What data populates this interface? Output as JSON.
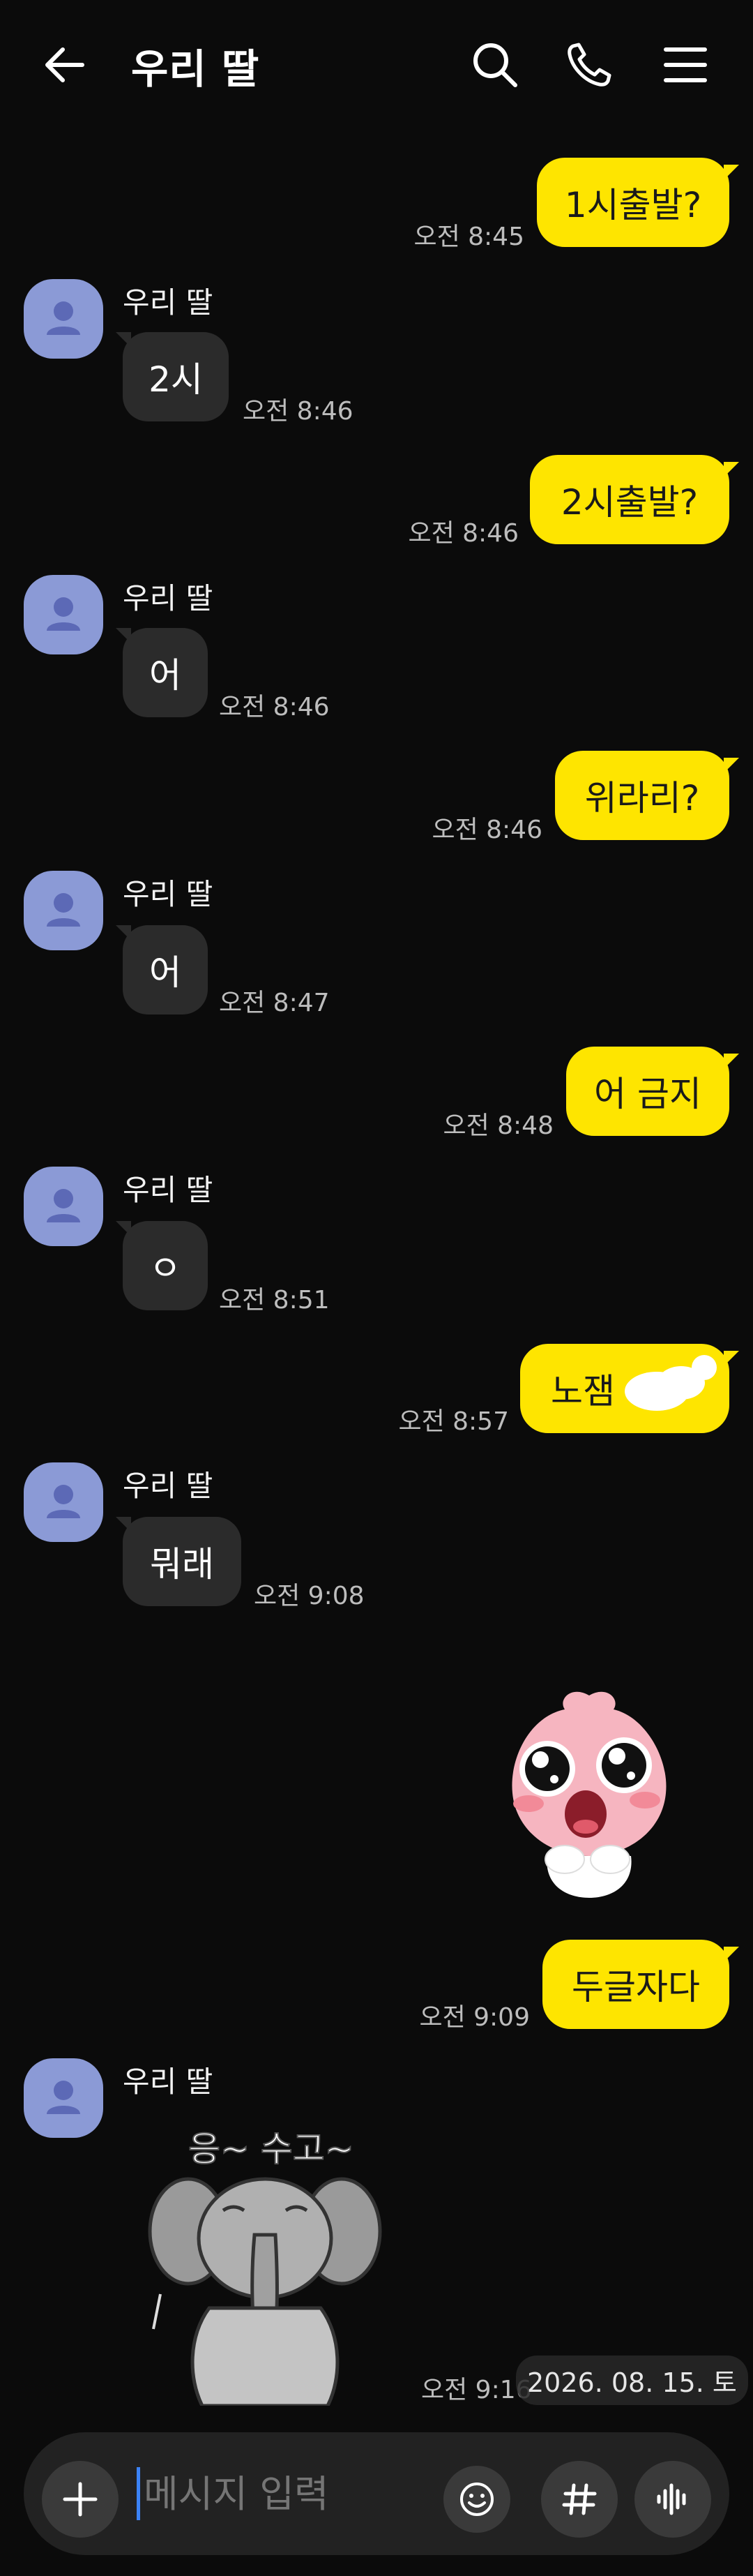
{
  "header": {
    "title": "우리 딸"
  },
  "messages": {
    "m1": {
      "text": "1시출발?",
      "time": "오전 8:45"
    },
    "m2": {
      "sender": "우리 딸",
      "text": "2시",
      "time": "오전 8:46"
    },
    "m3": {
      "text": "2시출발?",
      "time": "오전 8:46"
    },
    "m4": {
      "sender": "우리 딸",
      "text": "어",
      "time": "오전 8:46"
    },
    "m5": {
      "text": "위라리?",
      "time": "오전 8:46"
    },
    "m6": {
      "sender": "우리 딸",
      "text": "어",
      "time": "오전 8:47"
    },
    "m7": {
      "text": "어 금지",
      "time": "오전 8:48"
    },
    "m8": {
      "sender": "우리 딸",
      "text": "ㅇ",
      "time": "오전 8:51"
    },
    "m9": {
      "text": "노잼",
      "time": "오전 8:57"
    },
    "m10": {
      "sender": "우리 딸",
      "text": "뭐래",
      "time": "오전 9:08"
    },
    "m11": {
      "text": "두글자다",
      "time": "오전 9:09"
    },
    "m12": {
      "sender": "우리 딸",
      "sticker_text": "응~ 수고~",
      "time": "오전 9:16"
    }
  },
  "date_pill": "2026. 08. 15. 토",
  "composer": {
    "placeholder": "메시지 입력"
  },
  "colors": {
    "background": "#0b0b0b",
    "outgoing": "#fee500",
    "incoming": "#2b2b2b",
    "avatar": "#8b9ad6"
  },
  "icons": [
    "back-arrow-icon",
    "search-icon",
    "phone-icon",
    "menu-icon",
    "profile-icon",
    "plus-icon",
    "emoji-icon",
    "hash-icon",
    "voice-icon"
  ]
}
